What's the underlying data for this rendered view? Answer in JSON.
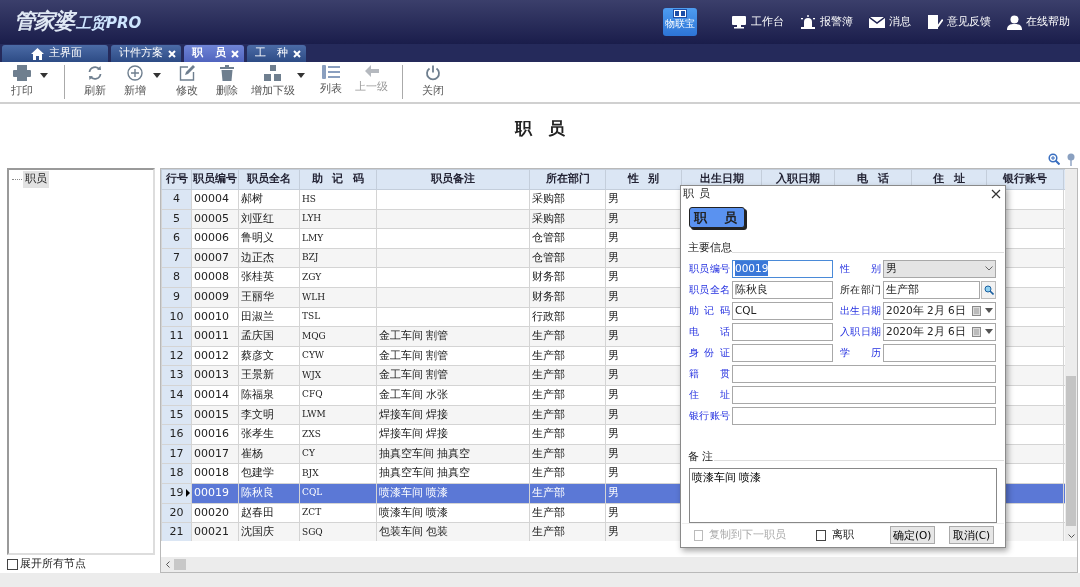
{
  "header": {
    "logo": "管家婆",
    "product": "工贸PRO",
    "app_label": "物联宝",
    "links": [
      "工作台",
      "报警簿",
      "消息",
      "意见反馈",
      "在线帮助"
    ]
  },
  "tabs": [
    {
      "label": "主界面",
      "kind": "home",
      "selected": false
    },
    {
      "label": "计件方案",
      "kind": "document",
      "selected": false
    },
    {
      "label": "职 员",
      "kind": "document",
      "selected": true
    },
    {
      "label": "工 种",
      "kind": "document",
      "selected": false
    }
  ],
  "toolbar": [
    [
      {
        "label": "打印",
        "dropdown": true,
        "disabled": false
      }
    ],
    [
      {
        "label": "刷新",
        "dropdown": false,
        "disabled": false
      },
      {
        "label": "新增",
        "dropdown": true,
        "disabled": false
      },
      {
        "label": "修改",
        "dropdown": false,
        "disabled": false
      },
      {
        "label": "删除",
        "dropdown": false,
        "disabled": false
      },
      {
        "label": "增加下级",
        "dropdown": true,
        "disabled": false
      },
      {
        "label": "列表",
        "dropdown": false,
        "disabled": false
      },
      {
        "label": "上一级",
        "dropdown": false,
        "disabled": true
      }
    ],
    [
      {
        "label": "关闭",
        "dropdown": false,
        "disabled": false
      }
    ]
  ],
  "page_title": "职 员",
  "tree": {
    "nodes": [
      {
        "label": "职员",
        "selected": true
      }
    ],
    "expand_all": {
      "label": "展开所有节点",
      "checked": false
    }
  },
  "grid": {
    "columns": [
      "行号",
      "职员编号",
      "职员全名",
      "助 记 码",
      "职员备注",
      "所在部门",
      "性 别",
      "出生日期",
      "入职日期",
      "电 话",
      "住 址",
      "银行账号"
    ],
    "rows": [
      {
        "no": "4",
        "id": "00004",
        "name": "郝树",
        "code": "HS",
        "dept": "采购部",
        "sex": "男",
        "selected": false
      },
      {
        "no": "5",
        "id": "00005",
        "name": "刘亚红",
        "code": "LYH",
        "dept": "采购部",
        "sex": "男",
        "selected": false
      },
      {
        "no": "6",
        "id": "00006",
        "name": "鲁明义",
        "code": "LMY",
        "dept": "仓管部",
        "sex": "男",
        "selected": false
      },
      {
        "no": "7",
        "id": "00007",
        "name": "边正杰",
        "code": "BZJ",
        "dept": "仓管部",
        "sex": "男",
        "selected": false
      },
      {
        "no": "8",
        "id": "00008",
        "name": "张桂英",
        "code": "ZGY",
        "dept": "财务部",
        "sex": "男",
        "selected": false
      },
      {
        "no": "9",
        "id": "00009",
        "name": "王丽华",
        "code": "WLH",
        "dept": "财务部",
        "sex": "男",
        "selected": false
      },
      {
        "no": "10",
        "id": "00010",
        "name": "田淑兰",
        "code": "TSL",
        "dept": "行政部",
        "sex": "男",
        "selected": false
      },
      {
        "no": "11",
        "id": "00011",
        "name": "孟庆国",
        "code": "MQG",
        "note": "金工车间 割管",
        "dept": "生产部",
        "sex": "男",
        "selected": false
      },
      {
        "no": "12",
        "id": "00012",
        "name": "蔡彦文",
        "code": "CYW",
        "note": "金工车间 割管",
        "dept": "生产部",
        "sex": "男",
        "selected": false
      },
      {
        "no": "13",
        "id": "00013",
        "name": "王景新",
        "code": "WJX",
        "note": "金工车间 割管",
        "dept": "生产部",
        "sex": "男",
        "selected": false
      },
      {
        "no": "14",
        "id": "00014",
        "name": "陈福泉",
        "code": "CFQ",
        "note": "金工车间 水张",
        "dept": "生产部",
        "sex": "男",
        "selected": false
      },
      {
        "no": "15",
        "id": "00015",
        "name": "李文明",
        "code": "LWM",
        "note": "焊接车间 焊接",
        "dept": "生产部",
        "sex": "男",
        "selected": false
      },
      {
        "no": "16",
        "id": "00016",
        "name": "张孝生",
        "code": "ZXS",
        "note": "焊接车间 焊接",
        "dept": "生产部",
        "sex": "男",
        "selected": false
      },
      {
        "no": "17",
        "id": "00017",
        "name": "崔杨",
        "code": "CY",
        "note": "抽真空车间 抽真空",
        "dept": "生产部",
        "sex": "男",
        "selected": false
      },
      {
        "no": "18",
        "id": "00018",
        "name": "包建学",
        "code": "BJX",
        "note": "抽真空车间 抽真空",
        "dept": "生产部",
        "sex": "男",
        "selected": false
      },
      {
        "no": "19",
        "id": "00019",
        "name": "陈秋良",
        "code": "CQL",
        "note": "喷漆车间 喷漆",
        "dept": "生产部",
        "sex": "男",
        "selected": true
      },
      {
        "no": "20",
        "id": "00020",
        "name": "赵春田",
        "code": "ZCT",
        "note": "喷漆车间 喷漆",
        "dept": "生产部",
        "sex": "男",
        "selected": false
      },
      {
        "no": "21",
        "id": "00021",
        "name": "沈国庆",
        "code": "SGQ",
        "note": "包装车间 包装",
        "dept": "生产部",
        "sex": "男",
        "selected": false
      }
    ]
  },
  "dialog": {
    "title": "职 员",
    "heading": "职 员",
    "section": "主要信息",
    "fields": [
      {
        "label": "职员编号",
        "kind": "text",
        "value": "00019",
        "highlighted": true,
        "text_selected": true
      },
      {
        "label": "性 别",
        "kind": "select",
        "value": "男",
        "highlighted": true,
        "text_selected": false
      },
      {
        "label": "职员全名",
        "kind": "text",
        "value": "陈秋良",
        "highlighted": true,
        "text_selected": false
      },
      {
        "label": "所在部门",
        "kind": "lookup",
        "value": "生产部",
        "highlighted": false,
        "text_selected": false
      },
      {
        "label": "助 记 码",
        "kind": "text",
        "value": "CQL",
        "highlighted": true,
        "text_selected": false
      },
      {
        "label": "出生日期",
        "kind": "date",
        "value": "2020年 2月 6日",
        "highlighted": true,
        "text_selected": false
      },
      {
        "label": "电 话",
        "kind": "text",
        "highlighted": true,
        "text_selected": false
      },
      {
        "label": "入职日期",
        "kind": "date",
        "value": "2020年 2月 6日",
        "highlighted": true,
        "text_selected": false
      },
      {
        "label": "身 份 证",
        "kind": "text",
        "highlighted": true,
        "text_selected": false
      },
      {
        "label": "学 历",
        "kind": "text",
        "highlighted": true,
        "text_selected": false
      },
      {
        "label": "籍 贯",
        "kind": "wide",
        "highlighted": true,
        "text_selected": false
      },
      {
        "label": "住 址",
        "kind": "wide",
        "highlighted": true,
        "text_selected": false
      },
      {
        "label": "银行账号",
        "kind": "wide",
        "highlighted": true,
        "text_selected": false
      }
    ],
    "notes_label": "备 注",
    "notes": "喷漆车间 喷漆",
    "options": [
      {
        "label": "复制到下一职员",
        "checked": false,
        "disabled": true
      },
      {
        "label": "离职",
        "checked": false,
        "disabled": false
      }
    ],
    "buttons": [
      "确定(O)",
      "取消(C)"
    ]
  }
}
